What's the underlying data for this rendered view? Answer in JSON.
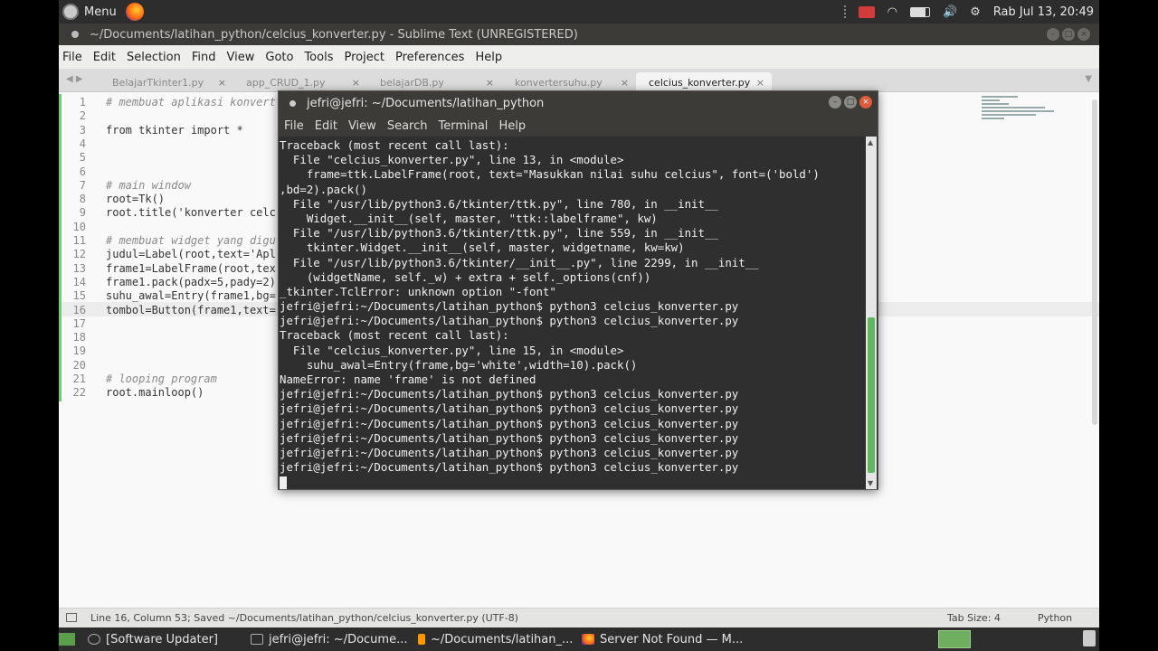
{
  "top_panel": {
    "menu_label": "Menu",
    "clock": "Rab Jul 13, 20:49"
  },
  "sublime": {
    "title": "~/Documents/latihan_python/celcius_konverter.py - Sublime Text (UNREGISTERED)",
    "menu": [
      "File",
      "Edit",
      "Selection",
      "Find",
      "View",
      "Goto",
      "Tools",
      "Project",
      "Preferences",
      "Help"
    ],
    "tabs": [
      "BelajarTkinter1.py",
      "app_CRUD_1.py",
      "belajarDB.py",
      "konvertersuhu.py",
      "celcius_konverter.py"
    ],
    "active_tab": "celcius_konverter.py",
    "lines": [
      {
        "n": "1",
        "text": "# membuat aplikasi konvert"
      },
      {
        "n": "2",
        "text": ""
      },
      {
        "n": "3",
        "text": "from tkinter import *"
      },
      {
        "n": "4",
        "text": ""
      },
      {
        "n": "5",
        "text": ""
      },
      {
        "n": "6",
        "text": ""
      },
      {
        "n": "7",
        "text": "# main window"
      },
      {
        "n": "8",
        "text": "root=Tk()"
      },
      {
        "n": "9",
        "text": "root.title('konverter celc"
      },
      {
        "n": "10",
        "text": ""
      },
      {
        "n": "11",
        "text": "# membuat widget yang digu"
      },
      {
        "n": "12",
        "text": "judul=Label(root,text='Apl"
      },
      {
        "n": "13",
        "text": "frame1=LabelFrame(root,tex"
      },
      {
        "n": "14",
        "text": "frame1.pack(padx=5,pady=2)"
      },
      {
        "n": "15",
        "text": "suhu_awal=Entry(frame1,bg="
      },
      {
        "n": "16",
        "text": "tombol=Button(frame1,text="
      },
      {
        "n": "17",
        "text": ""
      },
      {
        "n": "18",
        "text": ""
      },
      {
        "n": "19",
        "text": ""
      },
      {
        "n": "20",
        "text": ""
      },
      {
        "n": "21",
        "text": "# looping program"
      },
      {
        "n": "22",
        "text": "root.mainloop()"
      }
    ],
    "status": "Line 16, Column 53; Saved ~/Documents/latihan_python/celcius_konverter.py (UTF-8)",
    "tab_size": "Tab Size: 4",
    "syntax": "Python"
  },
  "terminal": {
    "title": "jefri@jefri: ~/Documents/latihan_python",
    "menu": [
      "File",
      "Edit",
      "View",
      "Search",
      "Terminal",
      "Help"
    ],
    "lines": [
      "Traceback (most recent call last):",
      "  File \"celcius_konverter.py\", line 13, in <module>",
      "    frame=ttk.LabelFrame(root, text=\"Masukkan nilai suhu celcius\", font=('bold')",
      ",bd=2).pack()",
      "  File \"/usr/lib/python3.6/tkinter/ttk.py\", line 780, in __init__",
      "    Widget.__init__(self, master, \"ttk::labelframe\", kw)",
      "  File \"/usr/lib/python3.6/tkinter/ttk.py\", line 559, in __init__",
      "    tkinter.Widget.__init__(self, master, widgetname, kw=kw)",
      "  File \"/usr/lib/python3.6/tkinter/__init__.py\", line 2299, in __init__",
      "    (widgetName, self._w) + extra + self._options(cnf))",
      "_tkinter.TclError: unknown option \"-font\"",
      "jefri@jefri:~/Documents/latihan_python$ python3 celcius_konverter.py",
      "jefri@jefri:~/Documents/latihan_python$ python3 celcius_konverter.py",
      "Traceback (most recent call last):",
      "  File \"celcius_konverter.py\", line 15, in <module>",
      "    suhu_awal=Entry(frame,bg='white',width=10).pack()",
      "NameError: name 'frame' is not defined",
      "jefri@jefri:~/Documents/latihan_python$ python3 celcius_konverter.py",
      "jefri@jefri:~/Documents/latihan_python$ python3 celcius_konverter.py",
      "jefri@jefri:~/Documents/latihan_python$ python3 celcius_konverter.py",
      "jefri@jefri:~/Documents/latihan_python$ python3 celcius_konverter.py",
      "jefri@jefri:~/Documents/latihan_python$ python3 celcius_konverter.py",
      "jefri@jefri:~/Documents/latihan_python$ python3 celcius_konverter.py"
    ]
  },
  "taskbar": {
    "items": [
      "[Software Updater]",
      "jefri@jefri: ~/Docume...",
      "~/Documents/latihan_...",
      "Server Not Found — M..."
    ]
  }
}
